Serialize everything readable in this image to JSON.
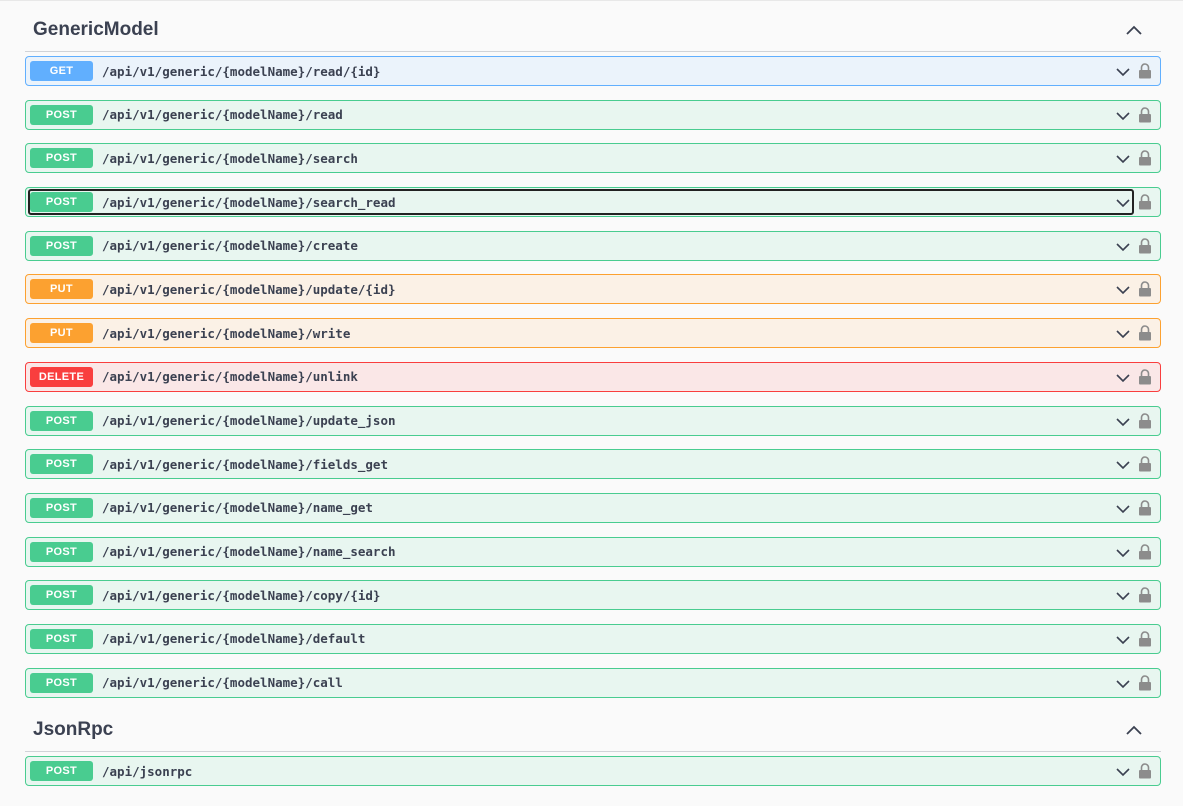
{
  "sections": [
    {
      "title": "GenericModel",
      "operations": [
        {
          "method": "GET",
          "path": "/api/v1/generic/{modelName}/read/{id}"
        },
        {
          "method": "POST",
          "path": "/api/v1/generic/{modelName}/read"
        },
        {
          "method": "POST",
          "path": "/api/v1/generic/{modelName}/search"
        },
        {
          "method": "POST",
          "path": "/api/v1/generic/{modelName}/search_read"
        },
        {
          "method": "POST",
          "path": "/api/v1/generic/{modelName}/create"
        },
        {
          "method": "PUT",
          "path": "/api/v1/generic/{modelName}/update/{id}"
        },
        {
          "method": "PUT",
          "path": "/api/v1/generic/{modelName}/write"
        },
        {
          "method": "DELETE",
          "path": "/api/v1/generic/{modelName}/unlink"
        },
        {
          "method": "POST",
          "path": "/api/v1/generic/{modelName}/update_json"
        },
        {
          "method": "POST",
          "path": "/api/v1/generic/{modelName}/fields_get"
        },
        {
          "method": "POST",
          "path": "/api/v1/generic/{modelName}/name_get"
        },
        {
          "method": "POST",
          "path": "/api/v1/generic/{modelName}/name_search"
        },
        {
          "method": "POST",
          "path": "/api/v1/generic/{modelName}/copy/{id}"
        },
        {
          "method": "POST",
          "path": "/api/v1/generic/{modelName}/default"
        },
        {
          "method": "POST",
          "path": "/api/v1/generic/{modelName}/call"
        }
      ]
    },
    {
      "title": "JsonRpc",
      "operations": [
        {
          "method": "POST",
          "path": "/api/jsonrpc"
        }
      ]
    }
  ],
  "icons": {
    "collapse": "chevron-up-icon",
    "expand": "chevron-down-icon",
    "authorize": "lock-icon"
  },
  "colors": {
    "GET": "#61affe",
    "POST": "#49cc90",
    "PUT": "#fca130",
    "DELETE": "#f93e3e"
  }
}
